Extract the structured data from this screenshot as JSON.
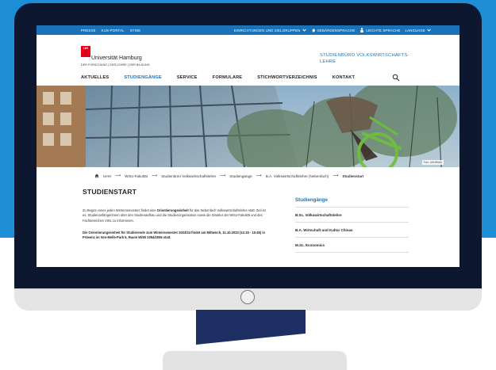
{
  "topbar": {
    "left_links": [
      "PRESSE",
      "KUS-PORTAL",
      "STINE"
    ],
    "right_links": [
      {
        "label": "EINRICHTUNGEN UND ZIELGRUPPEN",
        "icon": "chevron-down-icon"
      },
      {
        "label": "GEBÄRDENSPRACHE",
        "icon": "hand-icon"
      },
      {
        "label": "LEICHTE SPRACHE",
        "icon": "person-icon"
      },
      {
        "label": "LANGUAGE",
        "icon": "chevron-down-icon"
      }
    ]
  },
  "logo": {
    "badge": "UH",
    "name": "Universität Hamburg",
    "tagline": "DER FORSCHUNG | DER LEHRE | DER BILDUNG"
  },
  "site_title": "STUDIENBÜRO VOLKSWIRTSCHAFTS-LEHRE",
  "nav": {
    "items": [
      "AKTUELLES",
      "STUDIENGÄNGE",
      "SERVICE",
      "FORMULARE",
      "STICHWORTVERZEICHNIS",
      "KONTAKT"
    ],
    "active_index": 1
  },
  "hero": {
    "credit": "Foto: UHH/Bohn"
  },
  "breadcrumb": {
    "items": [
      "UHH",
      "WiSo-Fakultät",
      "Studienbüro Volkswirtschaftslehre",
      "Studiengänge",
      "B.A. Volkswirtschaftslehre (Nebenfach)",
      "Studienstart"
    ]
  },
  "content": {
    "title": "STUDIENSTART",
    "intro_before": "Zu Beginn eines jeden Wintersemesters findet eine ",
    "intro_bold": "Orientierungseinheit",
    "intro_after": " für das Nebenfach Volkswirtschaftslehre statt. Ziel ist es, Studienanfängerinnen über den Studienaufbau und die Studienorganisation sowie die Struktur der WiSo-Fakultät und des Fachbereiches VWL zu informieren.",
    "notice": "Die Orientierungseinheit für Studierende zum Wintersemester 2023/24 findet am Mittwoch, 11.10.2023 (14:15 - 15:45) in Präsenz im Von-Melle-Park 5, Raum WiWi 2054/2055 statt."
  },
  "sidebar": {
    "heading": "Studiengänge",
    "links": [
      "B.Sc. Volkswirtschaftslehre",
      "B.A. Wirtschaft und Kultur Chinas",
      "M.Sc. Economics"
    ]
  },
  "colors": {
    "brand_blue": "#1a73b8",
    "uhh_red": "#e2001a",
    "background_blue": "#1e8fd6",
    "bezel": "#0e1730"
  }
}
